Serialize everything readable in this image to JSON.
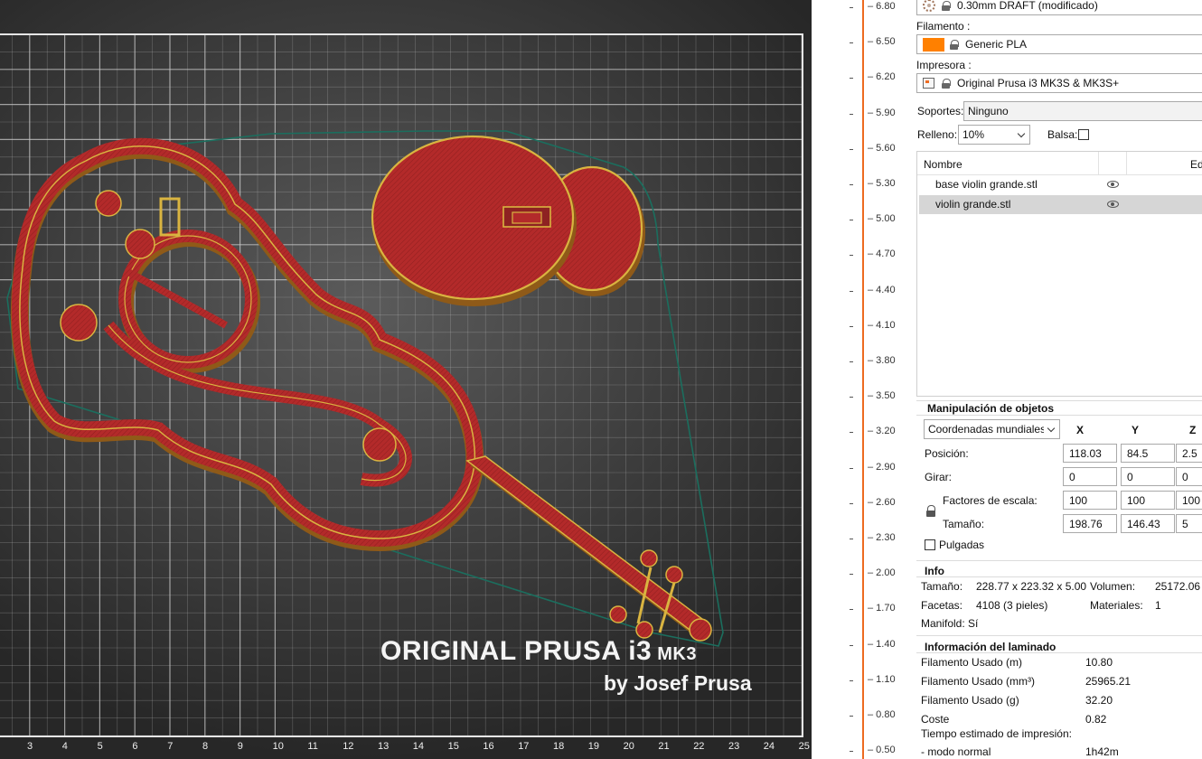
{
  "viewport": {
    "logo_line1": "ORIGINAL PRUSA i3",
    "logo_line1_model": "MK3",
    "logo_line2": "by Josef Prusa",
    "x_axis_ticks": [
      "3",
      "4",
      "5",
      "6",
      "7",
      "8",
      "9",
      "10",
      "11",
      "12",
      "13",
      "14",
      "15",
      "16",
      "17",
      "18",
      "19",
      "20",
      "21",
      "22",
      "23",
      "24",
      "25"
    ],
    "colors": {
      "bed_bg": "#3e3e3e",
      "grid": "#c8c8c8",
      "model_fill": "#b32a2a",
      "model_edge": "#d9b440",
      "skirt": "#1b6e5e"
    }
  },
  "layer_slider": {
    "labels": [
      "6.80",
      "6.50",
      "6.20",
      "5.90",
      "5.60",
      "5.30",
      "5.00",
      "4.70",
      "4.40",
      "4.10",
      "3.80",
      "3.50",
      "3.20",
      "2.90",
      "2.60",
      "2.30",
      "2.00",
      "1.70",
      "1.40",
      "1.10",
      "0.80",
      "0.50"
    ],
    "accent": "#ed6b21"
  },
  "sidebar": {
    "print_profile": "0.30mm DRAFT (modificado)",
    "filament_label": "Filamento :",
    "filament_value": "Generic PLA",
    "filament_color": "#ff8000",
    "printer_label": "Impresora :",
    "printer_value": "Original Prusa i3 MK3S & MK3S+",
    "supports_label": "Soportes:",
    "supports_value": "Ninguno",
    "infill_label": "Relleno:",
    "infill_value": "10%",
    "brim_label": "Balsa:",
    "object_list": {
      "col_name": "Nombre",
      "col_edit": "Ed",
      "items": [
        {
          "name": "base violin grande.stl",
          "selected": false
        },
        {
          "name": "violin grande.stl",
          "selected": true
        }
      ]
    },
    "manipulation": {
      "title": "Manipulación de objetos",
      "coords": "Coordenadas mundiales",
      "axis_x": "X",
      "axis_y": "Y",
      "axis_z": "Z",
      "position_label": "Posición:",
      "position": [
        "118.03",
        "84.5",
        "2.5"
      ],
      "rotate_label": "Girar:",
      "rotate": [
        "0",
        "0",
        "0"
      ],
      "scale_label": "Factores de escala:",
      "scale": [
        "100",
        "100",
        "100"
      ],
      "size_label": "Tamaño:",
      "size": [
        "198.76",
        "146.43",
        "5"
      ],
      "inches_label": "Pulgadas"
    },
    "info": {
      "title": "Info",
      "size_label": "Tamaño:",
      "size_value": "228.77 x 223.32 x 5.00",
      "volume_label": "Volumen:",
      "volume_value": "25172.06",
      "facets_label": "Facetas:",
      "facets_value": "4108 (3 pieles)",
      "materials_label": "Materiales:",
      "materials_value": "1",
      "manifold_text": "Manifold: Sí"
    },
    "slice_info": {
      "title": "Información del laminado",
      "rows": [
        {
          "label": "Filamento Usado (m)",
          "value": "10.80"
        },
        {
          "label": "Filamento Usado (mm³)",
          "value": "25965.21"
        },
        {
          "label": "Filamento Usado (g)",
          "value": "32.20"
        },
        {
          "label": "Coste",
          "value": "0.82"
        },
        {
          "label": "Tiempo estimado de impresión:",
          "value": ""
        },
        {
          "label": " - modo normal",
          "value": "1h42m"
        }
      ]
    }
  }
}
